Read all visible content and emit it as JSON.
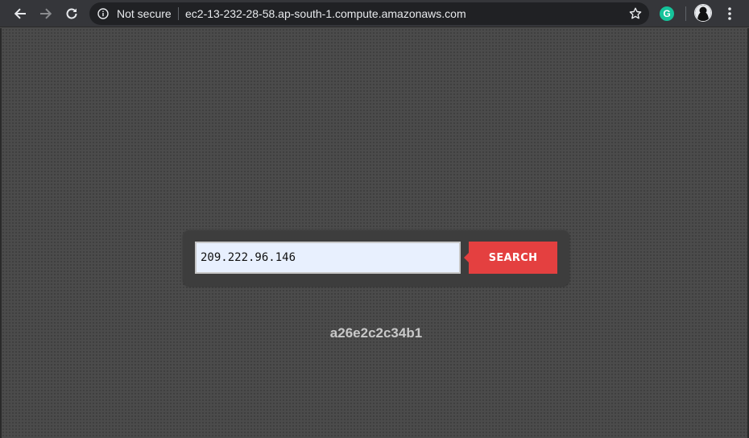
{
  "browser": {
    "security_label": "Not secure",
    "url": "ec2-13-232-28-58.ap-south-1.compute.amazonaws.com",
    "extension_letter": "G",
    "icons": {
      "back": "arrow-left-icon",
      "forward": "arrow-right-icon",
      "reload": "reload-icon",
      "info": "info-circle-icon",
      "bookmark": "star-icon",
      "extension": "grammarly-icon",
      "profile": "avatar-icon",
      "menu": "kebab-menu-icon"
    }
  },
  "page": {
    "search_value": "209.222.96.146",
    "search_button_label": "SEARCH",
    "host_id": "a26e2c2c34b1"
  },
  "colors": {
    "page_background": "#4b4b4b",
    "panel_background": "#3d3d3d",
    "button_accent": "#e44040",
    "input_background": "#e8f0fe",
    "host_id_text": "#c8c8c8",
    "toolbar_background": "#35363a"
  }
}
